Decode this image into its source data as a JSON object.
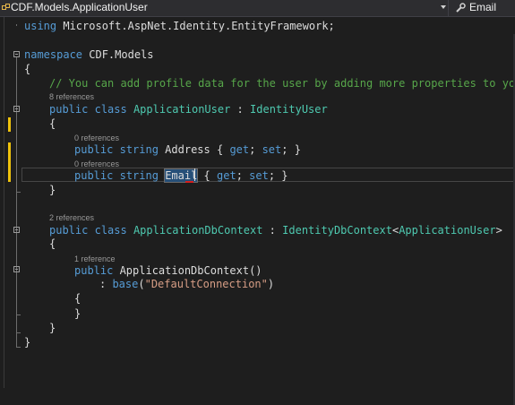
{
  "navbar": {
    "type_label": "CDF.Models.ApplicationUser",
    "member_label": "Email",
    "type_icon": "class-icon",
    "member_icon": "wrench-icon"
  },
  "code": {
    "line_using": {
      "kw": "using",
      "rest": " Microsoft.AspNet.Identity.EntityFramework;"
    },
    "line_namespace": {
      "kw": "namespace",
      "rest": " CDF.Models"
    },
    "brace_open_ns": "{",
    "comment": "// You can add profile data for the user by adding more properties to your",
    "lens_app_user": "8 references",
    "line_class1": {
      "kw1": "public",
      "kw2": "class",
      "name": "ApplicationUser",
      "sep": " : ",
      "base": "IdentityUser"
    },
    "brace_open_c1": "{",
    "lens_address": "0 references",
    "line_address": {
      "kw1": "public",
      "kw2": "string",
      "name": " Address { ",
      "get": "get",
      "mid": "; ",
      "set": "set",
      "end": "; }"
    },
    "lens_email": "0 references",
    "line_email": {
      "kw1": "public",
      "kw2": "string",
      "name": "Email",
      "rest": " { ",
      "get": "get",
      "mid": "; ",
      "set": "set",
      "end": "; }"
    },
    "brace_close_c1": "}",
    "lens_dbcontext": "2 references",
    "line_class2": {
      "kw1": "public",
      "kw2": "class",
      "name": "ApplicationDbContext",
      "sep": " : ",
      "base": "IdentityDbContext",
      "lt": "<",
      "arg": "ApplicationUser",
      "gt": ">"
    },
    "brace_open_c2": "{",
    "lens_ctor": "1 reference",
    "line_ctor": {
      "kw": "public",
      "rest": " ApplicationDbContext()"
    },
    "line_base": {
      "pre": ": ",
      "kw": "base",
      "open": "(",
      "str": "\"DefaultConnection\"",
      "close": ")"
    },
    "brace_open_ctor": "{",
    "brace_close_ctor": "}",
    "brace_close_c2": "}",
    "brace_close_ns": "}"
  },
  "colors": {
    "keyword": "#569cd6",
    "type": "#4ec9b0",
    "comment": "#57a64a",
    "string": "#d69d85",
    "text": "#dcdcdc",
    "change_marker": "#efc20c",
    "background": "#1e1e1e"
  }
}
